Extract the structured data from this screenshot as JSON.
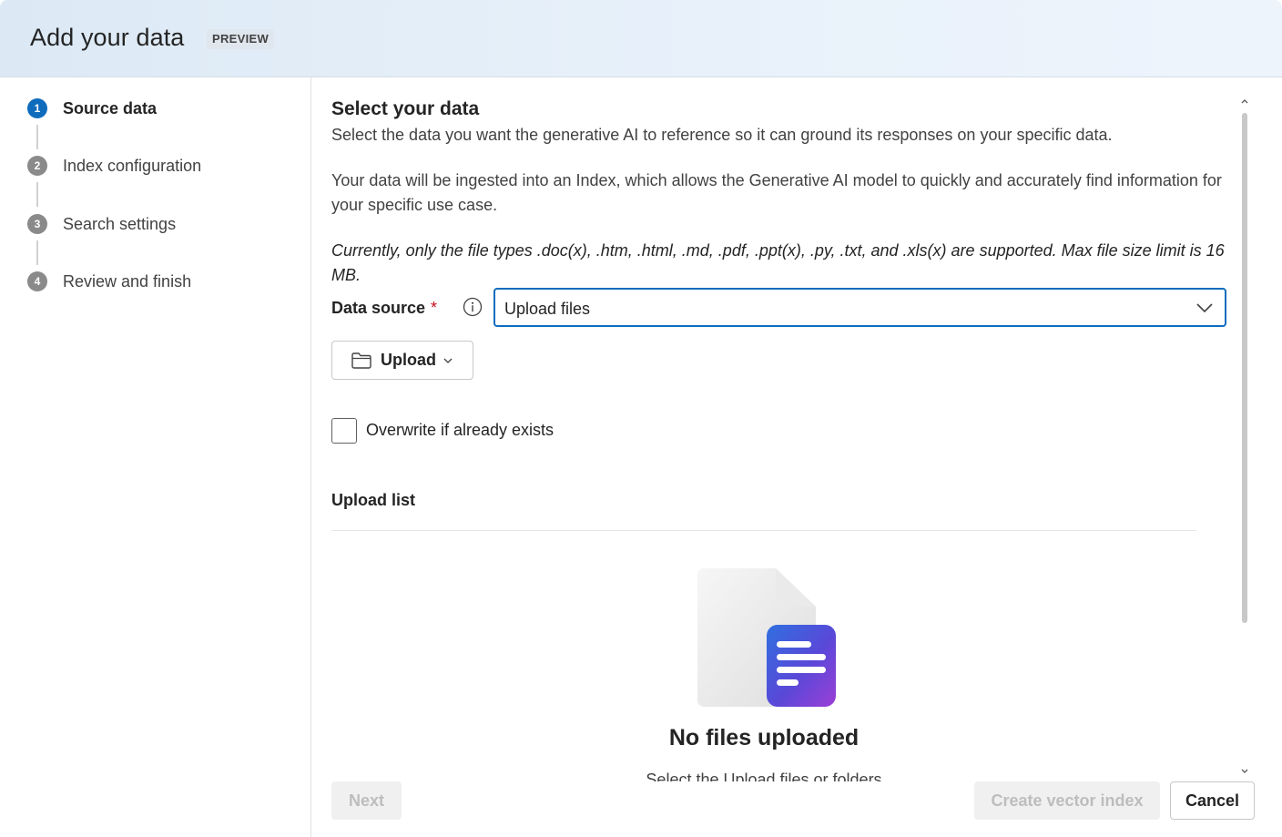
{
  "dialog": {
    "title": "Add your data",
    "badge": "PREVIEW"
  },
  "steps": [
    {
      "number": "1",
      "label": "Source data",
      "active": true
    },
    {
      "number": "2",
      "label": "Index configuration",
      "active": false
    },
    {
      "number": "3",
      "label": "Search settings",
      "active": false
    },
    {
      "number": "4",
      "label": "Review and finish",
      "active": false
    }
  ],
  "main": {
    "heading": "Select your data",
    "description": "Select the data you want the generative AI to reference so it can ground its responses on your specific data.",
    "index_note": "Your data will be ingested into an Index, which allows the Generative AI model to quickly and accurately find information for your specific use case.",
    "file_types_note": "Currently, only the file types .doc(x), .htm, .html, .md, .pdf, .ppt(x), .py, .txt, and .xls(x) are supported. Max file size limit is 16 MB.",
    "data_source": {
      "label": "Data source",
      "required_mark": "*",
      "selected": "Upload files"
    },
    "upload_button": "Upload",
    "overwrite_label": "Overwrite if already exists",
    "overwrite_checked": false,
    "upload_list_title": "Upload list",
    "empty_title": "No files uploaded",
    "empty_subtitle": "Select the Upload files or folders"
  },
  "footer": {
    "next": "Next",
    "create": "Create vector index",
    "cancel": "Cancel"
  },
  "colors": {
    "accent": "#0f6cbd",
    "required": "#c50f1f",
    "disabled_text": "#bdbdbd"
  }
}
